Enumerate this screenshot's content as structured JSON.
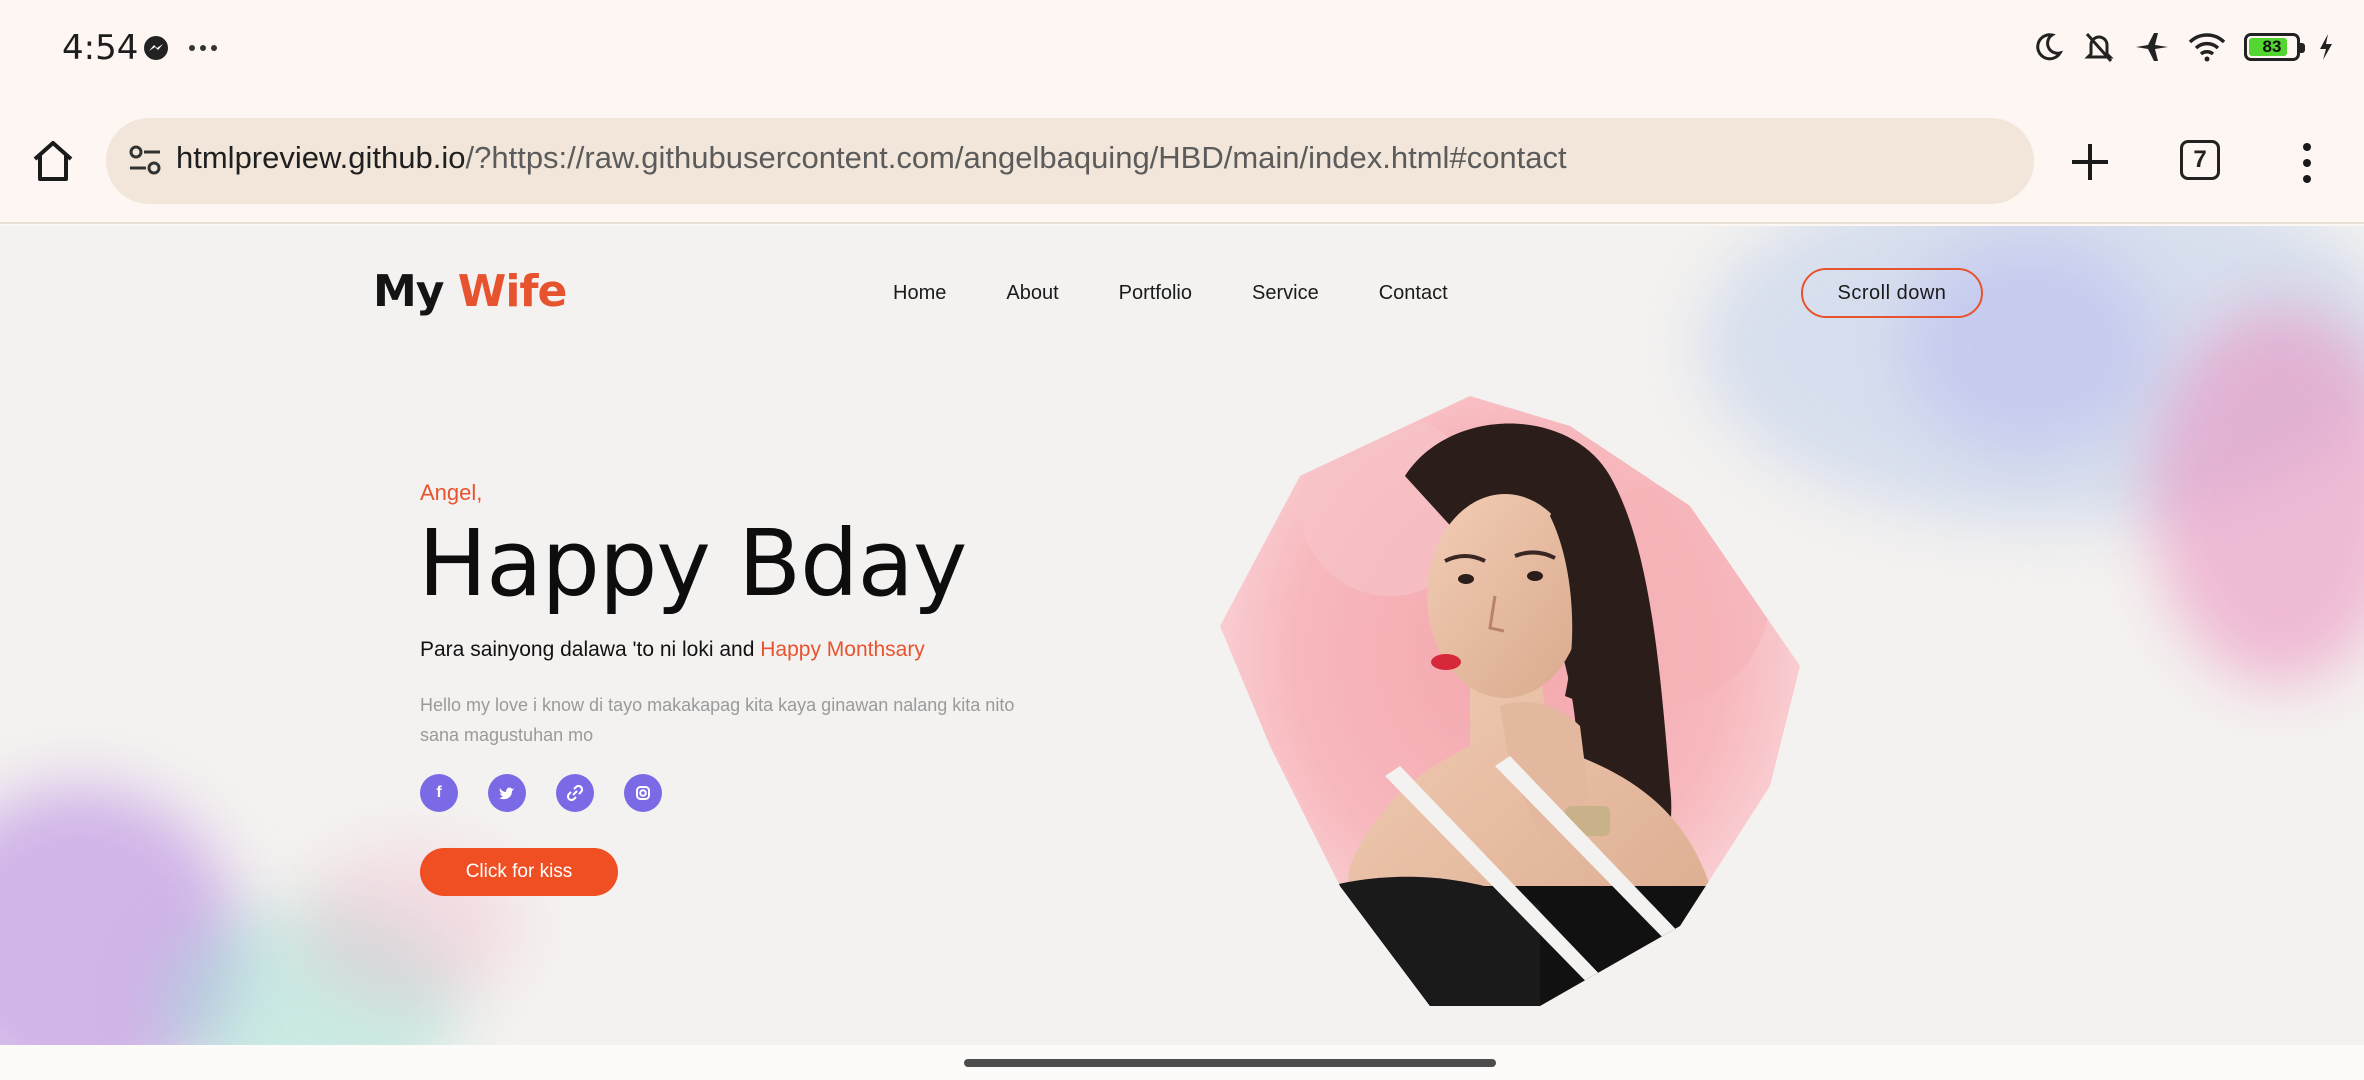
{
  "status_bar": {
    "time": "4:54",
    "battery_level": "83",
    "battery_fraction": 0.83,
    "icons": [
      "messenger-icon",
      "more-dots-icon",
      "moon-icon",
      "bell-off-icon",
      "airplane-icon",
      "wifi-icon",
      "battery-icon",
      "charging-icon"
    ]
  },
  "browser": {
    "url_host": "htmlpreview.github.io",
    "url_rest": "/?https://raw.githubusercontent.com/angelbaquing/HBD/main/index.html#contact",
    "tab_count": "7",
    "icons": [
      "home-icon",
      "site-settings-icon",
      "plus-icon",
      "overflow-menu-icon"
    ]
  },
  "site": {
    "logo_main": "My",
    "logo_accent": "Wife",
    "nav": [
      "Home",
      "About",
      "Portfolio",
      "Service",
      "Contact"
    ],
    "scroll_button": "Scroll down",
    "greeting": "Angel,",
    "headline": "Happy Bday",
    "subline_main": "Para sainyong dalawa 'to ni loki and",
    "subline_accent": "Happy Monthsary",
    "message": "Hello my love i know di tayo makakapag kita kaya ginawan nalang kita nito sana magustuhan mo",
    "socials": [
      {
        "icon": "facebook-icon",
        "glyph": "f"
      },
      {
        "icon": "twitter-icon",
        "glyph": "🐦"
      },
      {
        "icon": "link-icon",
        "glyph": "🔗"
      },
      {
        "icon": "instagram-icon",
        "glyph": "◎"
      }
    ],
    "cta": "Click for kiss"
  },
  "colors": {
    "accent": "#e8532f",
    "cta": "#f04e23",
    "social": "#7b6ae6",
    "page_bg": "#f4f2f0",
    "chrome_bg": "#fdf6f2",
    "url_box": "#f2e6da"
  }
}
